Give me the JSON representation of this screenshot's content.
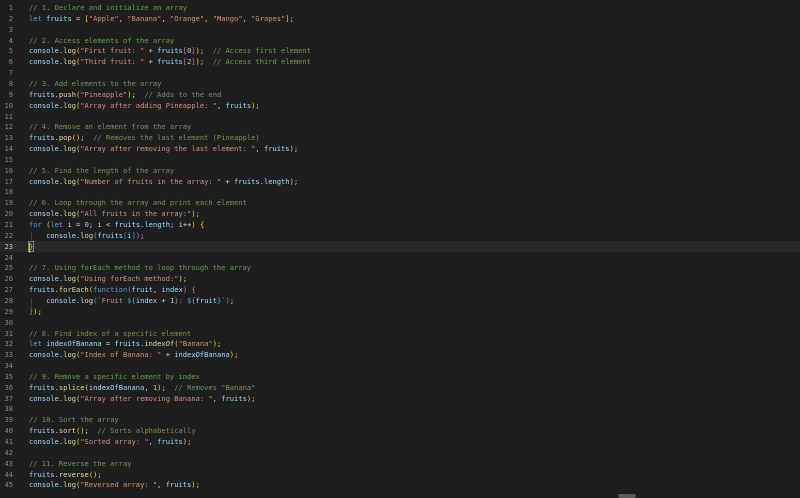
{
  "editor": {
    "lines": [
      {
        "n": "1",
        "t": [
          [
            "c",
            "// 1. Declare and initialize an array"
          ]
        ]
      },
      {
        "n": "2",
        "t": [
          [
            "k",
            "let "
          ],
          [
            "v",
            "fruits"
          ],
          [
            "p",
            " = "
          ],
          [
            "b1",
            "["
          ],
          [
            "s",
            "\"Apple\""
          ],
          [
            "p",
            ", "
          ],
          [
            "s",
            "\"Banana\""
          ],
          [
            "p",
            ", "
          ],
          [
            "s",
            "\"Orange\""
          ],
          [
            "p",
            ", "
          ],
          [
            "s",
            "\"Mango\""
          ],
          [
            "p",
            ", "
          ],
          [
            "s",
            "\"Grapes\""
          ],
          [
            "b1",
            "]"
          ],
          [
            "p",
            ";"
          ]
        ]
      },
      {
        "n": "3",
        "t": []
      },
      {
        "n": "4",
        "t": [
          [
            "c",
            "// 2. Access elements of the array"
          ]
        ]
      },
      {
        "n": "5",
        "t": [
          [
            "v",
            "console"
          ],
          [
            "p",
            "."
          ],
          [
            "f",
            "log"
          ],
          [
            "b1",
            "("
          ],
          [
            "s",
            "\"First fruit: \""
          ],
          [
            "p",
            " + "
          ],
          [
            "v",
            "fruits"
          ],
          [
            "b2",
            "["
          ],
          [
            "n",
            "0"
          ],
          [
            "b2",
            "]"
          ],
          [
            "b1",
            ")"
          ],
          [
            "p",
            ";  "
          ],
          [
            "c",
            "// Access first element"
          ]
        ]
      },
      {
        "n": "6",
        "t": [
          [
            "v",
            "console"
          ],
          [
            "p",
            "."
          ],
          [
            "f",
            "log"
          ],
          [
            "b1",
            "("
          ],
          [
            "s",
            "\"Third fruit: \""
          ],
          [
            "p",
            " + "
          ],
          [
            "v",
            "fruits"
          ],
          [
            "b2",
            "["
          ],
          [
            "n",
            "2"
          ],
          [
            "b2",
            "]"
          ],
          [
            "b1",
            ")"
          ],
          [
            "p",
            ";  "
          ],
          [
            "c",
            "// Access third element"
          ]
        ]
      },
      {
        "n": "7",
        "t": []
      },
      {
        "n": "8",
        "t": [
          [
            "c",
            "// 3. Add elements to the array"
          ]
        ]
      },
      {
        "n": "9",
        "t": [
          [
            "v",
            "fruits"
          ],
          [
            "p",
            "."
          ],
          [
            "f",
            "push"
          ],
          [
            "b1",
            "("
          ],
          [
            "s",
            "\"Pineapple\""
          ],
          [
            "b1",
            ")"
          ],
          [
            "p",
            ";  "
          ],
          [
            "c",
            "// Adds to the end"
          ]
        ]
      },
      {
        "n": "10",
        "t": [
          [
            "v",
            "console"
          ],
          [
            "p",
            "."
          ],
          [
            "f",
            "log"
          ],
          [
            "b1",
            "("
          ],
          [
            "s",
            "\"Array after adding Pineapple: \""
          ],
          [
            "p",
            ", "
          ],
          [
            "v",
            "fruits"
          ],
          [
            "b1",
            ")"
          ],
          [
            "p",
            ";"
          ]
        ]
      },
      {
        "n": "11",
        "t": []
      },
      {
        "n": "12",
        "t": [
          [
            "c",
            "// 4. Remove an element from the array"
          ]
        ]
      },
      {
        "n": "13",
        "t": [
          [
            "v",
            "fruits"
          ],
          [
            "p",
            "."
          ],
          [
            "f",
            "pop"
          ],
          [
            "b1",
            "()"
          ],
          [
            "p",
            ";  "
          ],
          [
            "c",
            "// Removes the last element (Pineapple)"
          ]
        ]
      },
      {
        "n": "14",
        "t": [
          [
            "v",
            "console"
          ],
          [
            "p",
            "."
          ],
          [
            "f",
            "log"
          ],
          [
            "b1",
            "("
          ],
          [
            "s",
            "\"Array after removing the last element: \""
          ],
          [
            "p",
            ", "
          ],
          [
            "v",
            "fruits"
          ],
          [
            "b1",
            ")"
          ],
          [
            "p",
            ";"
          ]
        ]
      },
      {
        "n": "15",
        "t": []
      },
      {
        "n": "16",
        "t": [
          [
            "c",
            "// 5. Find the length of the array"
          ]
        ]
      },
      {
        "n": "17",
        "t": [
          [
            "v",
            "console"
          ],
          [
            "p",
            "."
          ],
          [
            "f",
            "log"
          ],
          [
            "b1",
            "("
          ],
          [
            "s",
            "\"Number of fruits in the array: \""
          ],
          [
            "p",
            " + "
          ],
          [
            "v",
            "fruits"
          ],
          [
            "p",
            "."
          ],
          [
            "v",
            "length"
          ],
          [
            "b1",
            ")"
          ],
          [
            "p",
            ";"
          ]
        ]
      },
      {
        "n": "18",
        "t": []
      },
      {
        "n": "19",
        "t": [
          [
            "c",
            "// 6. Loop through the array and print each element"
          ]
        ]
      },
      {
        "n": "20",
        "t": [
          [
            "v",
            "console"
          ],
          [
            "p",
            "."
          ],
          [
            "f",
            "log"
          ],
          [
            "b1",
            "("
          ],
          [
            "s",
            "\"All fruits in the array:\""
          ],
          [
            "b1",
            ")"
          ],
          [
            "p",
            ";"
          ]
        ]
      },
      {
        "n": "21",
        "t": [
          [
            "k",
            "for "
          ],
          [
            "b1",
            "("
          ],
          [
            "k",
            "let "
          ],
          [
            "v",
            "i"
          ],
          [
            "p",
            " = "
          ],
          [
            "n",
            "0"
          ],
          [
            "p",
            "; "
          ],
          [
            "v",
            "i"
          ],
          [
            "p",
            " < "
          ],
          [
            "v",
            "fruits"
          ],
          [
            "p",
            "."
          ],
          [
            "v",
            "length"
          ],
          [
            "p",
            "; "
          ],
          [
            "v",
            "i"
          ],
          [
            "p",
            "++"
          ],
          [
            "b1",
            ")"
          ],
          [
            "p",
            " "
          ],
          [
            "b1",
            "{"
          ]
        ]
      },
      {
        "n": "22",
        "t": [
          [
            "p",
            "    "
          ],
          [
            "v",
            "console"
          ],
          [
            "p",
            "."
          ],
          [
            "f",
            "log"
          ],
          [
            "b2",
            "("
          ],
          [
            "v",
            "fruits"
          ],
          [
            "b3",
            "["
          ],
          [
            "v",
            "i"
          ],
          [
            "b3",
            "]"
          ],
          [
            "b2",
            ")"
          ],
          [
            "p",
            ";"
          ]
        ]
      },
      {
        "n": "23",
        "t": [
          [
            "b1",
            "}"
          ]
        ]
      },
      {
        "n": "24",
        "t": []
      },
      {
        "n": "25",
        "t": [
          [
            "c",
            "// 7. Using forEach method to loop through the array"
          ]
        ]
      },
      {
        "n": "26",
        "t": [
          [
            "v",
            "console"
          ],
          [
            "p",
            "."
          ],
          [
            "f",
            "log"
          ],
          [
            "b1",
            "("
          ],
          [
            "s",
            "\"Using forEach method:\""
          ],
          [
            "b1",
            ")"
          ],
          [
            "p",
            ";"
          ]
        ]
      },
      {
        "n": "27",
        "t": [
          [
            "v",
            "fruits"
          ],
          [
            "p",
            "."
          ],
          [
            "f",
            "forEach"
          ],
          [
            "b1",
            "("
          ],
          [
            "k",
            "function"
          ],
          [
            "b2",
            "("
          ],
          [
            "v",
            "fruit"
          ],
          [
            "p",
            ", "
          ],
          [
            "v",
            "index"
          ],
          [
            "b2",
            ")"
          ],
          [
            "p",
            " "
          ],
          [
            "b2",
            "{"
          ]
        ]
      },
      {
        "n": "28",
        "t": [
          [
            "p",
            "    "
          ],
          [
            "v",
            "console"
          ],
          [
            "p",
            "."
          ],
          [
            "f",
            "log"
          ],
          [
            "b3",
            "("
          ],
          [
            "s",
            "`Fruit "
          ],
          [
            "k",
            "${"
          ],
          [
            "v",
            "index"
          ],
          [
            "p",
            " + "
          ],
          [
            "n",
            "1"
          ],
          [
            "k",
            "}"
          ],
          [
            "s",
            ": "
          ],
          [
            "k",
            "${"
          ],
          [
            "v",
            "fruit"
          ],
          [
            "k",
            "}"
          ],
          [
            "s",
            "`"
          ],
          [
            "b3",
            ")"
          ],
          [
            "p",
            ";"
          ]
        ]
      },
      {
        "n": "29",
        "t": [
          [
            "b2",
            "}"
          ],
          [
            "b1",
            ")"
          ],
          [
            "p",
            ";"
          ]
        ]
      },
      {
        "n": "30",
        "t": []
      },
      {
        "n": "31",
        "t": [
          [
            "c",
            "// 8. Find index of a specific element"
          ]
        ]
      },
      {
        "n": "32",
        "t": [
          [
            "k",
            "let "
          ],
          [
            "v",
            "indexOfBanana"
          ],
          [
            "p",
            " = "
          ],
          [
            "v",
            "fruits"
          ],
          [
            "p",
            "."
          ],
          [
            "f",
            "indexOf"
          ],
          [
            "b1",
            "("
          ],
          [
            "s",
            "\"Banana\""
          ],
          [
            "b1",
            ")"
          ],
          [
            "p",
            ";"
          ]
        ]
      },
      {
        "n": "33",
        "t": [
          [
            "v",
            "console"
          ],
          [
            "p",
            "."
          ],
          [
            "f",
            "log"
          ],
          [
            "b1",
            "("
          ],
          [
            "s",
            "\"Index of Banana: \""
          ],
          [
            "p",
            " + "
          ],
          [
            "v",
            "indexOfBanana"
          ],
          [
            "b1",
            ")"
          ],
          [
            "p",
            ";"
          ]
        ]
      },
      {
        "n": "34",
        "t": []
      },
      {
        "n": "35",
        "t": [
          [
            "c",
            "// 9. Remove a specific element by index"
          ]
        ]
      },
      {
        "n": "36",
        "t": [
          [
            "v",
            "fruits"
          ],
          [
            "p",
            "."
          ],
          [
            "f",
            "splice"
          ],
          [
            "b1",
            "("
          ],
          [
            "v",
            "indexOfBanana"
          ],
          [
            "p",
            ", "
          ],
          [
            "n",
            "1"
          ],
          [
            "b1",
            ")"
          ],
          [
            "p",
            ";  "
          ],
          [
            "c",
            "// Removes \"Banana\""
          ]
        ]
      },
      {
        "n": "37",
        "t": [
          [
            "v",
            "console"
          ],
          [
            "p",
            "."
          ],
          [
            "f",
            "log"
          ],
          [
            "b1",
            "("
          ],
          [
            "s",
            "\"Array after removing Banana: \""
          ],
          [
            "p",
            ", "
          ],
          [
            "v",
            "fruits"
          ],
          [
            "b1",
            ")"
          ],
          [
            "p",
            ";"
          ]
        ]
      },
      {
        "n": "38",
        "t": []
      },
      {
        "n": "39",
        "t": [
          [
            "c",
            "// 10. Sort the array"
          ]
        ]
      },
      {
        "n": "40",
        "t": [
          [
            "v",
            "fruits"
          ],
          [
            "p",
            "."
          ],
          [
            "f",
            "sort"
          ],
          [
            "b1",
            "()"
          ],
          [
            "p",
            ";  "
          ],
          [
            "c",
            "// Sorts alphabetically"
          ]
        ]
      },
      {
        "n": "41",
        "t": [
          [
            "v",
            "console"
          ],
          [
            "p",
            "."
          ],
          [
            "f",
            "log"
          ],
          [
            "b1",
            "("
          ],
          [
            "s",
            "\"Sorted array: \""
          ],
          [
            "p",
            ", "
          ],
          [
            "v",
            "fruits"
          ],
          [
            "b1",
            ")"
          ],
          [
            "p",
            ";"
          ]
        ]
      },
      {
        "n": "42",
        "t": []
      },
      {
        "n": "43",
        "t": [
          [
            "c",
            "// 11. Reverse the array"
          ]
        ]
      },
      {
        "n": "44",
        "t": [
          [
            "v",
            "fruits"
          ],
          [
            "p",
            "."
          ],
          [
            "f",
            "reverse"
          ],
          [
            "b1",
            "()"
          ],
          [
            "p",
            ";"
          ]
        ]
      },
      {
        "n": "45",
        "t": [
          [
            "v",
            "console"
          ],
          [
            "p",
            "."
          ],
          [
            "f",
            "log"
          ],
          [
            "b1",
            "("
          ],
          [
            "s",
            "\"Reversed array: \""
          ],
          [
            "p",
            ", "
          ],
          [
            "v",
            "fruits"
          ],
          [
            "b1",
            ")"
          ],
          [
            "p",
            ";"
          ]
        ]
      }
    ],
    "active_line": "23",
    "colors": {
      "background": "#1e1e1e",
      "comment": "#6a9955",
      "keyword": "#569cd6",
      "string": "#ce9178",
      "variable": "#9cdcfe",
      "function": "#dcdcaa",
      "number": "#b5cea8"
    }
  }
}
